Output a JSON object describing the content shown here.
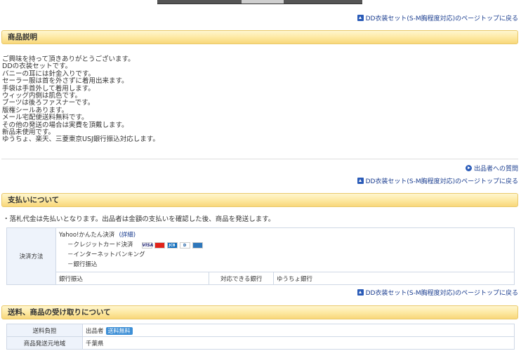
{
  "toplink_text": "DD衣装セット(S-M胸程度対応)のページトップに戻る",
  "sections": {
    "description": "商品説明",
    "payment": "支払いについて",
    "shipping": "送料、商品の受け取りについて"
  },
  "description_lines": [
    "ご興味を持って頂きありがとうございます。",
    "DDの衣装セットです。",
    "バニーの耳には針金入りです。",
    "セーラー服は首を外さずに着用出来ます。",
    "手袋は手首外して着用します。",
    "ウィッグ内側は肌色です。",
    "ブーツは後ろファスナーです。",
    "版権シールあります。",
    "メール宅配便送料無料です。",
    "その他の発送の場合は実費を頂戴します。",
    "新品未使用です。",
    "ゆうちょ、楽天、三菱東京USJ銀行振込対応します。"
  ],
  "question_link": "出品者への質問",
  "payment": {
    "note": "・落札代金は先払いとなります。出品者は金額の支払いを確認した後、商品を発送します。",
    "method_label": "決済方法",
    "yahoo_pay": "Yahoo!かんたん決済",
    "detail_link": "(詳細)",
    "sub_items": [
      "－クレジットカード決済",
      "－インターネットバンキング",
      "－銀行振込"
    ],
    "cards": [
      "VISA",
      "MC",
      "JCB",
      "D",
      "AMEX"
    ],
    "bank_transfer": "銀行振込",
    "banks_label": "対応できる銀行",
    "banks_value": "ゆうちょ銀行"
  },
  "shipping": {
    "burden_label": "送料負担",
    "burden_value": "出品者",
    "free_badge": "送料無料",
    "origin_label": "商品発送元地域",
    "origin_value": "千葉県"
  },
  "colors": {
    "link": "#1a3d8f",
    "header_bg": "#fde8a0",
    "label_bg": "#eef3fb",
    "badge": "#3d8fd6"
  }
}
